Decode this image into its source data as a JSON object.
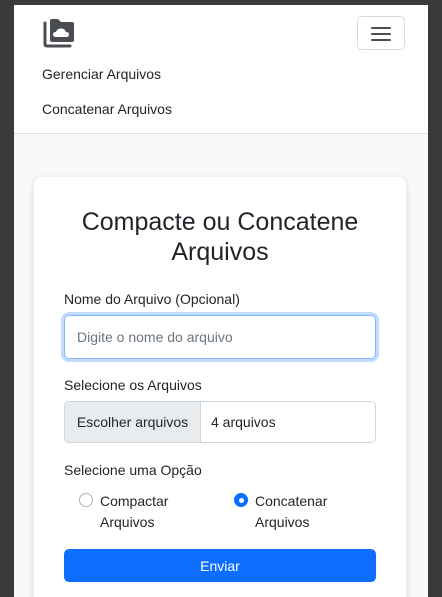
{
  "navbar": {
    "brand_icon": "folder-cloud-icon",
    "toggler_icon": "hamburger-icon",
    "links": [
      {
        "label": "Gerenciar Arquivos"
      },
      {
        "label": "Concatenar Arquivos"
      }
    ]
  },
  "form": {
    "title": "Compacte ou Concatene Arquivos",
    "name_label": "Nome do Arquivo (Opcional)",
    "name_placeholder": "Digite o nome do arquivo",
    "name_value": "",
    "files_label": "Selecione os Arquivos",
    "file_button": "Escolher arquivos",
    "file_count": "4 arquivos",
    "option_label": "Selecione uma Opção",
    "options": [
      {
        "label": "Compactar Arquivos",
        "checked": false
      },
      {
        "label": "Concatenar Arquivos",
        "checked": true
      }
    ],
    "submit_label": "Enviar"
  },
  "colors": {
    "primary": "#0d6efd",
    "page_bg": "#f8f9fa",
    "frame_bg": "#3a3a3a"
  }
}
